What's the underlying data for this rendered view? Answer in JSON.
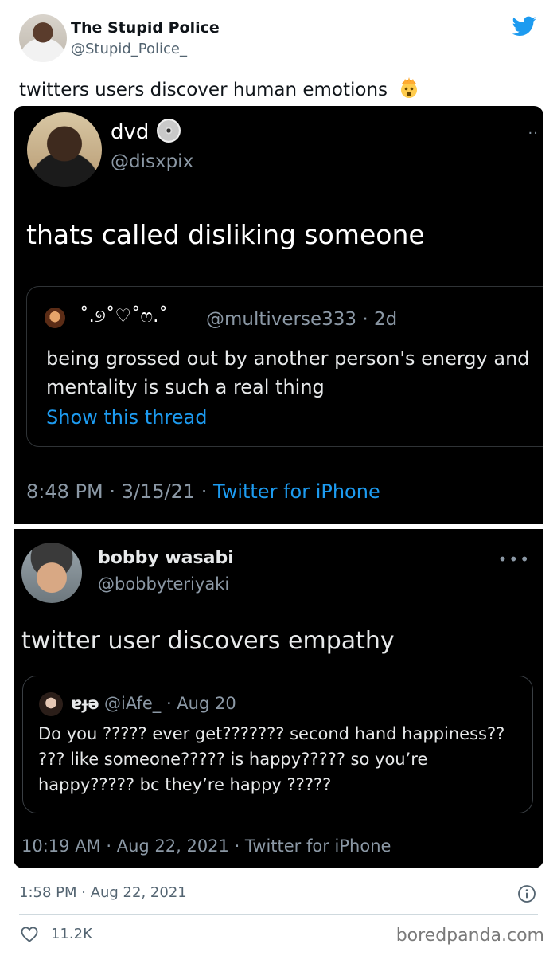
{
  "outer_tweet": {
    "name": "The Stupid Police",
    "handle": "@Stupid_Police_",
    "text": "twitters users discover human emotions",
    "emoji": "exploding-head-emoji",
    "timestamp": "1:58 PM · Aug 22, 2021",
    "likes": "11.2K",
    "brand_color": "#1d9bf0"
  },
  "embedded_tweet_1": {
    "name": "dvd",
    "name_icon": "cd-disc-icon",
    "handle": "@disxpix",
    "text": "thats called disliking someone",
    "quote": {
      "name": "˚.୭˚♡˚ෆ.˚",
      "handle": "@multiverse333 · 2d",
      "text": "being grossed out by another person's energy and mentality is such a real thing",
      "link": "Show this thread"
    },
    "meta_time": "8:48 PM · 3/15/21 · ",
    "meta_source": "Twitter for iPhone"
  },
  "embedded_tweet_2": {
    "name": "bobby wasabi",
    "handle": "@bobbyteriyaki",
    "text": "twitter user discovers empathy",
    "quote": {
      "name": "ɐɟə",
      "handle": "@iAfe_ · Aug 20",
      "text": "Do you ????? ever get??????? second hand happiness?? ??? like someone????? is happy????? so you’re happy????? bc they’re happy ?????"
    },
    "meta": "10:19 AM · Aug 22, 2021 · Twitter for iPhone"
  },
  "watermark": "boredpanda.com"
}
